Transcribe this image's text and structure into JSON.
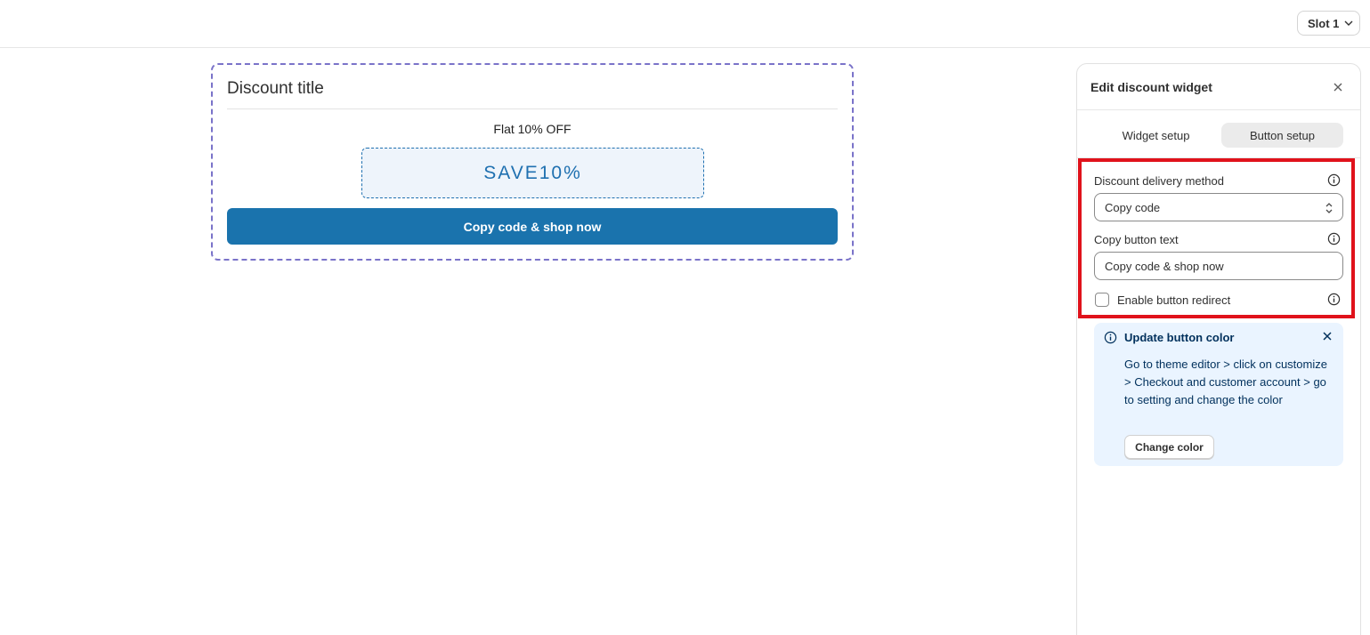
{
  "topbar": {
    "slot_label": "Slot 1",
    "slot_icon": "chevron-down-icon"
  },
  "preview": {
    "title": "Discount title",
    "offer": "Flat 10% OFF",
    "code": "SAVE10%",
    "cta_label": "Copy code & shop now",
    "cta_color": "#1a73ad",
    "border_color": "#7a73c9"
  },
  "panel": {
    "title": "Edit discount widget",
    "close_icon": "close-icon",
    "tabs": [
      {
        "label": "Widget setup",
        "active": false
      },
      {
        "label": "Button setup",
        "active": true
      }
    ],
    "fields": {
      "delivery_label": "Discount delivery method",
      "delivery_value": "Copy code",
      "copy_text_label": "Copy button text",
      "copy_text_value": "Copy code & shop now",
      "redirect_label": "Enable button redirect",
      "redirect_checked": false,
      "info_icon": "info-icon"
    },
    "highlight_color": "#e0121b",
    "banner": {
      "title": "Update button color",
      "body": "Go to theme editor > click on customize > Checkout and customer account > go to setting and change the color",
      "button_label": "Change color",
      "background": "#eaf4ff"
    }
  }
}
